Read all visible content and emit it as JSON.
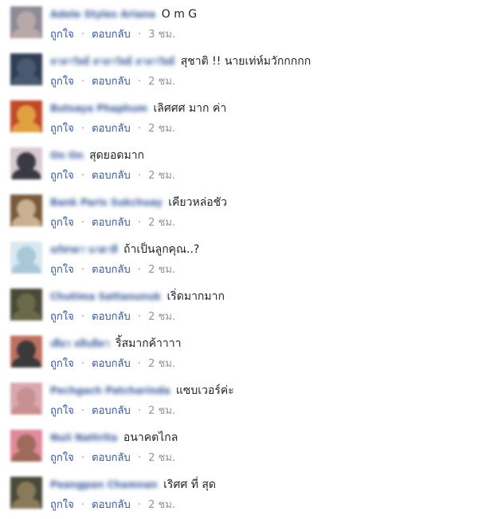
{
  "actions": {
    "like": "ถูกใจ",
    "reply": "ตอบกลับ",
    "separator": "·"
  },
  "comments": [
    {
      "author": "Adele Styles Ariana",
      "text": "O m G",
      "time": "3 ชม.",
      "avatar": [
        "#b9a8a8",
        "#8f8a96"
      ]
    },
    {
      "author": "ลาลาวัลย์ ลาลาวัลย์ ลาลาวัลย์",
      "text": "สุชาติ !! นายเท่ห์มวักกกกก",
      "time": "2 ชม.",
      "avatar": [
        "#4a5a6e",
        "#2f3f55"
      ]
    },
    {
      "author": "Butsaya Phaphum",
      "text": "เลิศศศ มาก ค่า",
      "time": "2 ชม.",
      "avatar": [
        "#e0a040",
        "#c04a2a"
      ]
    },
    {
      "author": "On On",
      "text": "สุดยอดมาก",
      "time": "2 ชม.",
      "avatar": [
        "#3a3a44",
        "#d8c8d0"
      ]
    },
    {
      "author": "Bank Paris Sukchuay",
      "text": "เคียวหล่อชัว",
      "time": "2 ชม.",
      "avatar": [
        "#c8b090",
        "#7a5a3a"
      ]
    },
    {
      "author": "ลภัสรดา นาตาลี",
      "text": "ถ้าเป็นลูกคุณ..?",
      "time": "2 ชม.",
      "avatar": [
        "#a8c8d8",
        "#d8e8f0"
      ]
    },
    {
      "author": "Chutima Sattanunuk",
      "text": "เริ่ดมากมาก",
      "time": "2 ชม.",
      "avatar": [
        "#6a6a4a",
        "#4a4a38"
      ]
    },
    {
      "author": "เดียว ลลินธิดา",
      "text": "ริ้สมากค้าาาา",
      "time": "2 ชม.",
      "avatar": [
        "#3a3a3a",
        "#c07060"
      ]
    },
    {
      "author": "Pechgach Patcharinda",
      "text": "แซบเวอร์ค่ะ",
      "time": "2 ชม.",
      "avatar": [
        "#c89090",
        "#d8a8b0"
      ]
    },
    {
      "author": "Nuii Nattrita",
      "text": "อนาคตไกล",
      "time": "2 ชม.",
      "avatar": [
        "#a06a5a",
        "#e08a9a"
      ]
    },
    {
      "author": "Peangpan Chamnan",
      "text": "เริศศ ที่ สุด",
      "time": "2 ชม.",
      "avatar": [
        "#8a7a5a",
        "#4a4a3a"
      ]
    }
  ]
}
